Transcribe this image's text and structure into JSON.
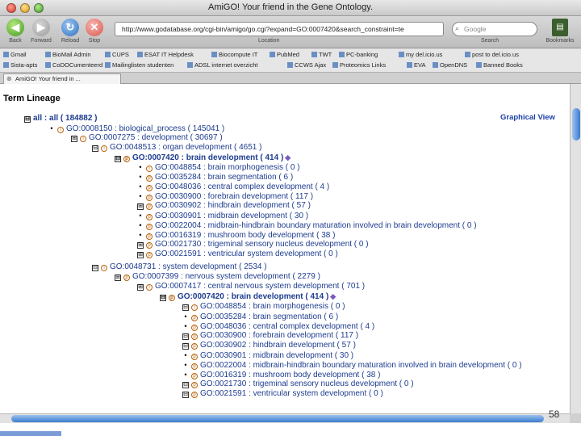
{
  "window": {
    "title": "AmiGO! Your friend in the Gene Ontology."
  },
  "toolbar": {
    "back_label": "Back",
    "forward_label": "Forward",
    "reload_label": "Reload",
    "stop_label": "Stop",
    "address_value": "http://www.godatabase.org/cgi-bin/amigo/go.cgi?expand=GO:0007420&search_constraint=te",
    "address_label": "Location",
    "search_placeholder": "Google",
    "search_label": "Search",
    "bookmarks_label": "Bookmarks"
  },
  "bookmarks": {
    "row1": [
      "Gmail",
      "BioMail Admin",
      "CUPS",
      "ESAT IT Helpdesk",
      "Biocompute IT",
      "PubMed",
      "TWT",
      "PC-banking",
      "my del.icio.us",
      "post to del.icio.us"
    ],
    "row2": [
      "Sista-apts",
      "CoDOCumenteerd",
      "Mailinglisten studenten",
      "ADSL internet overzicht",
      "CCWS Ajax",
      "Proteomics Links",
      "EVA",
      "OpenDNS",
      "Banned Books"
    ]
  },
  "tab": {
    "label": "AmiGO! Your friend in ..."
  },
  "page": {
    "heading": "Term Lineage",
    "graphical_view": "Graphical View",
    "rows": [
      {
        "text": "all : all ( 184882 )",
        "marker": "⊟"
      },
      {
        "text": "GO:0008150 : biological_process ( 145041 )",
        "marker": "•"
      },
      {
        "text": "GO:0007275 : development ( 30697 )",
        "marker": "⊞"
      },
      {
        "text": "GO:0048513 : organ development ( 4651 )",
        "marker": "⊟"
      },
      {
        "text": "GO:0007420 : brain development ( 414 )",
        "marker": "⊟"
      },
      {
        "text": "GO:0048854 : brain morphogenesis ( 0 )",
        "marker": "•"
      },
      {
        "text": "GO:0035284 : brain segmentation ( 6 )",
        "marker": "•"
      },
      {
        "text": "GO:0048036 : central complex development ( 4 )",
        "marker": "•"
      },
      {
        "text": "GO:0030900 : forebrain development ( 117 )",
        "marker": "•"
      },
      {
        "text": "GO:0030902 : hindbrain development ( 57 )",
        "marker": "⊞"
      },
      {
        "text": "GO:0030901 : midbrain development ( 30 )",
        "marker": "•"
      },
      {
        "text": "GO:0022004 : midbrain-hindbrain boundary maturation involved in brain development ( 0 )",
        "marker": "•"
      },
      {
        "text": "GO:0016319 : mushroom body development ( 38 )",
        "marker": "•"
      },
      {
        "text": "GO:0021730 : trigeminal sensory nucleus development ( 0 )",
        "marker": "⊞"
      },
      {
        "text": "GO:0021591 : ventricular system development ( 0 )",
        "marker": "⊞"
      },
      {
        "text": "GO:0048731 : system development ( 2534 )",
        "marker": "⊟"
      },
      {
        "text": "GO:0007399 : nervous system development ( 2279 )",
        "marker": "⊞"
      },
      {
        "text": "GO:0007417 : central nervous system development ( 701 )",
        "marker": "⊞"
      },
      {
        "text": "GO:0007420 : brain development ( 414 )",
        "marker": "⊟"
      },
      {
        "text": "GO:0048854 : brain morphogenesis ( 0 )",
        "marker": "⊟"
      },
      {
        "text": "GO:0035284 : brain segmentation ( 6 )",
        "marker": "•"
      },
      {
        "text": "GO:0048036 : central complex development ( 4 )",
        "marker": "•"
      },
      {
        "text": "GO:0030900 : forebrain development ( 117 )",
        "marker": "⊟"
      },
      {
        "text": "GO:0030902 : hindbrain development ( 57 )",
        "marker": "⊟"
      },
      {
        "text": "GO:0030901 : midbrain development ( 30 )",
        "marker": "•"
      },
      {
        "text": "GO:0022004 : midbrain-hindbrain boundary maturation involved in brain development ( 0 )",
        "marker": "•"
      },
      {
        "text": "GO:0016319 : mushroom body development ( 38 )",
        "marker": "•"
      },
      {
        "text": "GO:0021730 : trigeminal sensory nucleus development ( 0 )",
        "marker": "⊟"
      },
      {
        "text": "GO:0021591 : ventricular system development ( 0 )",
        "marker": "⊟"
      }
    ]
  },
  "slide_number": "58"
}
